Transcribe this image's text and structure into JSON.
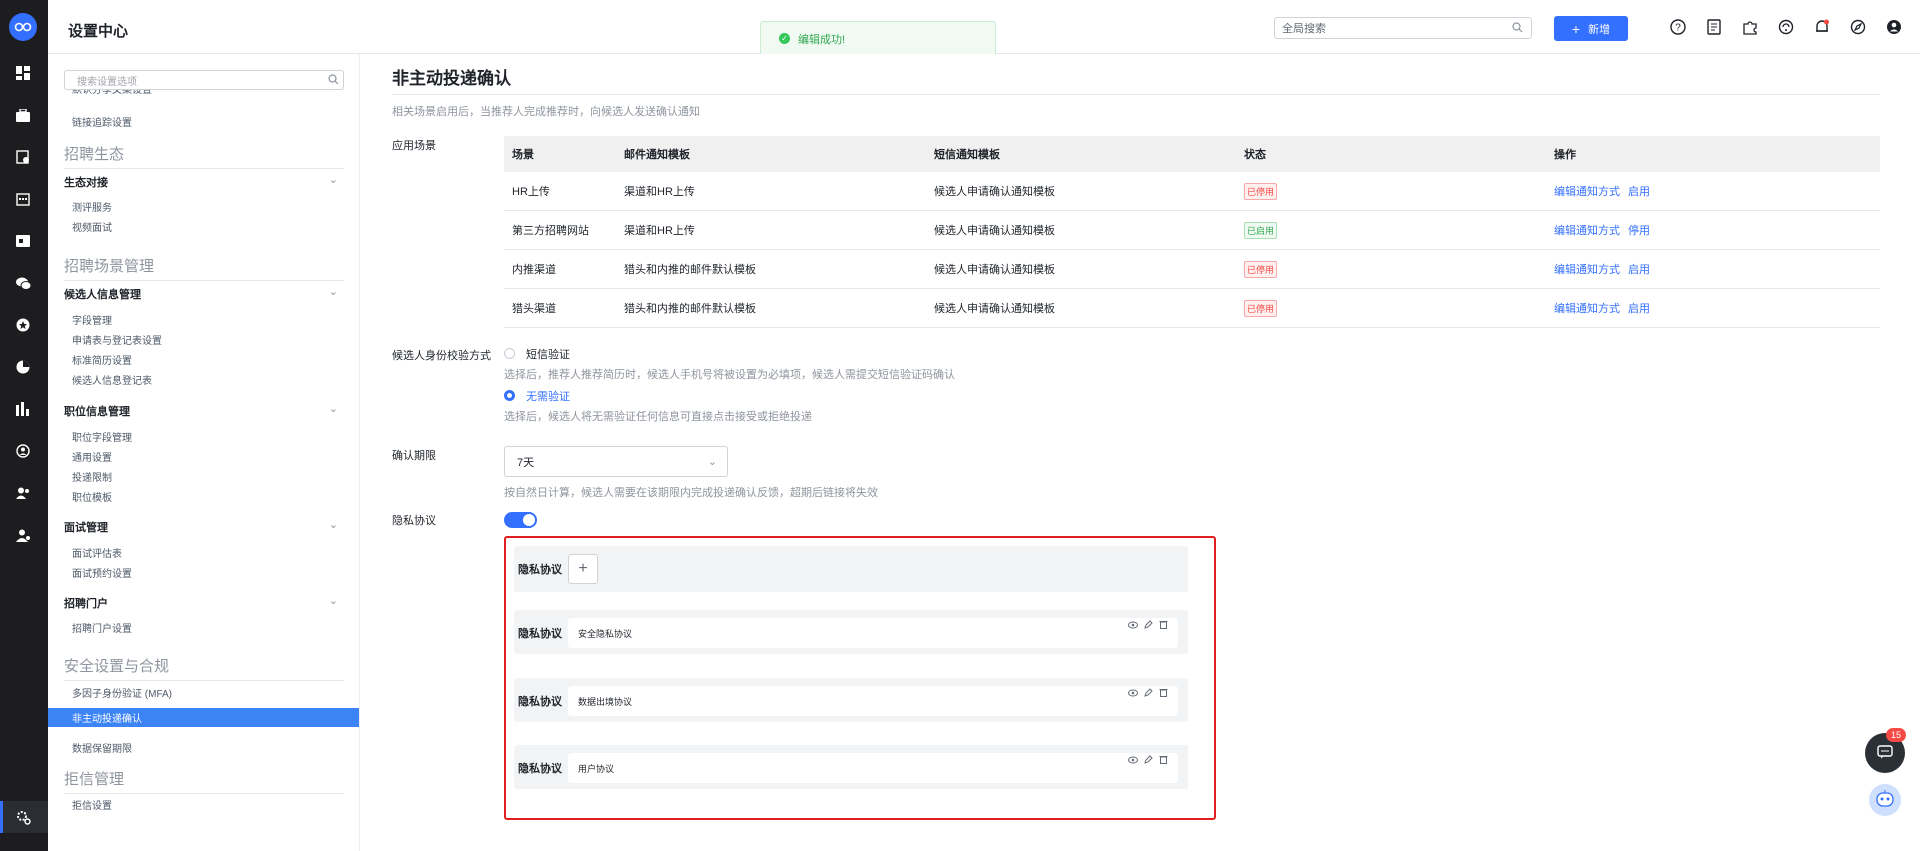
{
  "app": {
    "title": "设置中心"
  },
  "toast": {
    "text": "编辑成功!"
  },
  "topbar": {
    "search_placeholder": "全局搜索",
    "new_label": "新增"
  },
  "sidebar": {
    "search_placeholder": "搜索设置选项",
    "cut_item": "默认分享文案设置",
    "link_track": "链接追踪设置",
    "groups": {
      "eco": "招聘生态",
      "scene": "招聘场景管理",
      "security": "安全设置与合规",
      "reject": "拒信管理"
    },
    "subs": {
      "eco_link": "生态对接",
      "cand": "候选人信息管理",
      "job": "职位信息管理",
      "interview": "面试管理",
      "portal": "招聘门户"
    },
    "items": {
      "test_service": "测评服务",
      "video_interview": "视频面试",
      "field_mgmt": "字段管理",
      "apply_form": "申请表与登记表设置",
      "std_resume": "标准简历设置",
      "cand_reg": "候选人信息登记表",
      "job_field": "职位字段管理",
      "general": "通用设置",
      "delivery_limit": "投递限制",
      "job_template": "职位模板",
      "eval_form": "面试评估表",
      "booking": "面试预约设置",
      "portal_setting": "招聘门户设置",
      "mfa": "多因子身份验证 (MFA)",
      "passive": "非主动投递确认",
      "retention": "数据保留期限",
      "reject_setting": "拒信设置"
    }
  },
  "main": {
    "title": "非主动投递确认",
    "desc": "相关场景启用后，当推荐人完成推荐时，向候选人发送确认通知",
    "scene_label": "应用场景",
    "table": {
      "headers": [
        "场景",
        "邮件通知模板",
        "短信通知模板",
        "状态",
        "操作"
      ],
      "rows": [
        {
          "scene": "HR上传",
          "mail": "渠道和HR上传",
          "sms": "候选人申请确认通知模板",
          "status": "已停用",
          "status_on": false,
          "edit": "编辑通知方式",
          "toggle": "启用"
        },
        {
          "scene": "第三方招聘网站",
          "mail": "渠道和HR上传",
          "sms": "候选人申请确认通知模板",
          "status": "已启用",
          "status_on": true,
          "edit": "编辑通知方式",
          "toggle": "停用"
        },
        {
          "scene": "内推渠道",
          "mail": "猎头和内推的邮件默认模板",
          "sms": "候选人申请确认通知模板",
          "status": "已停用",
          "status_on": false,
          "edit": "编辑通知方式",
          "toggle": "启用"
        },
        {
          "scene": "猎头渠道",
          "mail": "猎头和内推的邮件默认模板",
          "sms": "候选人申请确认通知模板",
          "status": "已停用",
          "status_on": false,
          "edit": "编辑通知方式",
          "toggle": "启用"
        }
      ]
    },
    "verify": {
      "label": "候选人身份校验方式",
      "opt1": "短信验证",
      "opt1_desc": "选择后，推荐人推荐简历时，候选人手机号将被设置为必填项，候选人需提交短信验证码确认",
      "opt2": "无需验证",
      "opt2_desc": "选择后，候选人将无需验证任何信息可直接点击接受或拒绝投递",
      "selected": "opt2"
    },
    "deadline": {
      "label": "确认期限",
      "value": "7天",
      "desc": "按自然日计算，候选人需要在该期限内完成投递确认反馈，超期后链接将失效"
    },
    "privacy": {
      "label": "隐私协议",
      "enabled": true,
      "card_label": "隐私协议",
      "items": [
        "安全隐私协议",
        "数据出境协议",
        "用户协议"
      ]
    }
  },
  "chat": {
    "badge": "15"
  },
  "colors": {
    "accent": "#3370ff",
    "success": "#34a853",
    "danger": "#f54a45",
    "highlight": "#e02020"
  }
}
